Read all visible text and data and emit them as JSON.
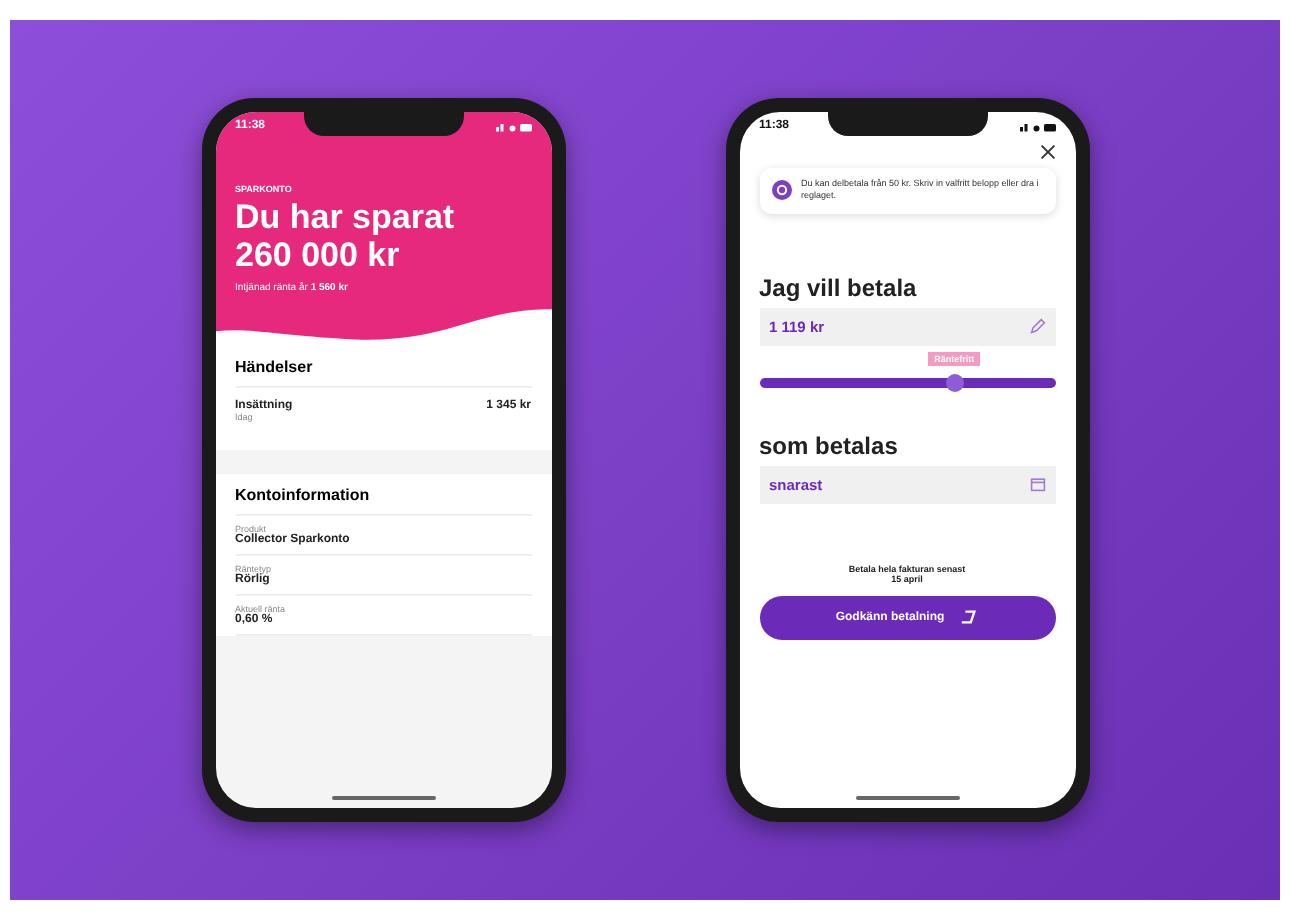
{
  "left_phone": {
    "time": "11:38",
    "header": {
      "eyebrow": "SPARKONTO",
      "title": "Du har sparat 260 000 kr",
      "interest": "Intjänad ränta år **1 560 kr**"
    },
    "events": {
      "title": "Händelser",
      "items": [
        {
          "label": "Insättning",
          "date": "Idag",
          "amount": "1 345 kr"
        }
      ]
    },
    "account_info": {
      "title": "Kontoinformation",
      "rows": [
        {
          "label": "Produkt",
          "value": "Collector Sparkonto"
        },
        {
          "label": "Räntetyp",
          "value": "Rörlig"
        },
        {
          "label": "Aktuell ränta",
          "value": "0,60 %"
        }
      ]
    }
  },
  "right_phone": {
    "time": "11:38",
    "info": "Du kan delbetala från 50 kr. Skriv in valfritt belopp eller dra i reglaget.",
    "amount_title": "Jag vill betala",
    "amount_value": "1 119 kr",
    "slider": {
      "badge": "Räntefritt",
      "level": 0.66
    },
    "when_title": "som betalas",
    "when_value": "snarast",
    "note": "Betala hela fakturan senast 15 april",
    "button": "Godkänn betalning"
  }
}
